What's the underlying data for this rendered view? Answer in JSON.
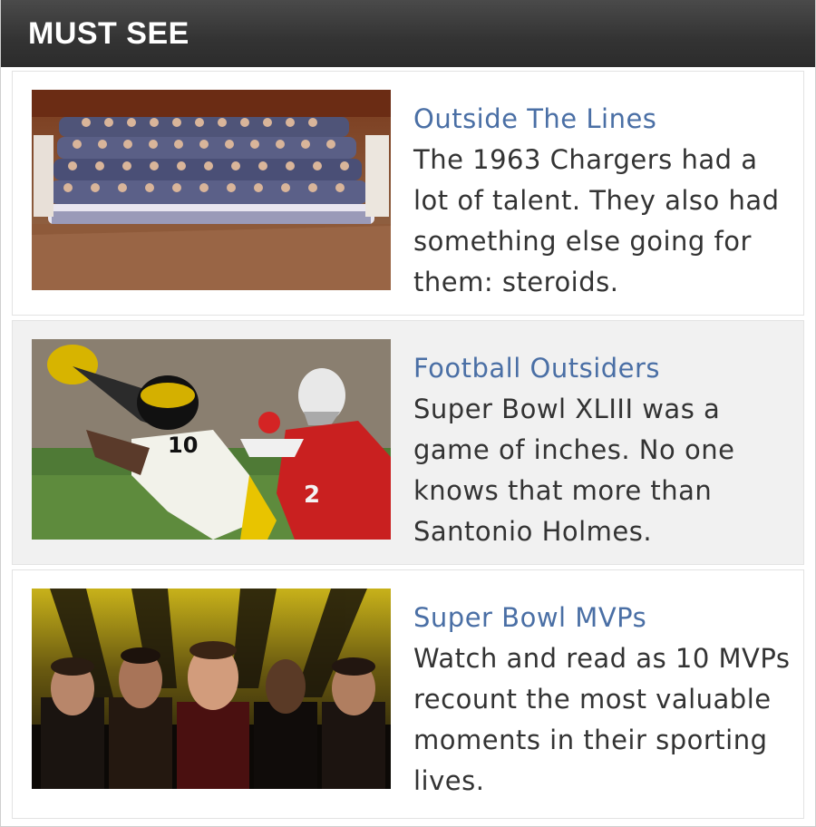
{
  "header": {
    "title": "MUST SEE"
  },
  "items": [
    {
      "headline": "Outside The Lines",
      "description": "The 1963 Chargers had a lot of talent. They also had something else going for them: steroids.",
      "image": "team-photo"
    },
    {
      "headline": "Football Outsiders",
      "description": "Super Bowl XLIII was a game of inches. No one knows that more than Santonio Holmes.",
      "image": "catch-photo"
    },
    {
      "headline": "Super Bowl MVPs",
      "description": "Watch and read as 10 MVPs recount the most valuable moments in their sporting lives.",
      "image": "mvp-photo"
    }
  ]
}
